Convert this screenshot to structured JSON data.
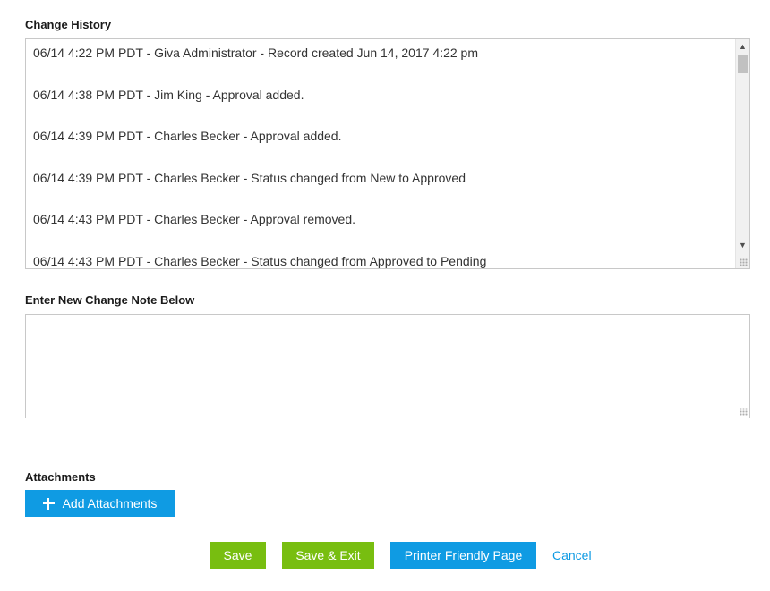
{
  "change_history": {
    "label": "Change History",
    "entries": [
      "06/14 4:22 PM PDT - Giva Administrator - Record created Jun 14, 2017 4:22 pm",
      "06/14 4:38 PM PDT - Jim King - Approval added.",
      "06/14 4:39 PM PDT - Charles Becker - Approval added.",
      "06/14 4:39 PM PDT - Charles Becker - Status changed from New to Approved",
      "06/14 4:43 PM PDT - Charles Becker - Approval removed.",
      "06/14 4:43 PM PDT - Charles Becker - Status changed from Approved to Pending"
    ],
    "scroll_up_icon": "chevron-up-icon",
    "scroll_down_icon": "chevron-down-icon"
  },
  "new_note": {
    "label": "Enter New Change Note Below",
    "value": ""
  },
  "attachments": {
    "label": "Attachments",
    "add_button_label": "Add Attachments",
    "add_icon": "plus-icon"
  },
  "actions": {
    "save_label": "Save",
    "save_exit_label": "Save & Exit",
    "printer_label": "Printer Friendly Page",
    "cancel_label": "Cancel"
  },
  "colors": {
    "primary_blue": "#0f9be3",
    "primary_green": "#78be10",
    "border": "#c8c8c8"
  }
}
